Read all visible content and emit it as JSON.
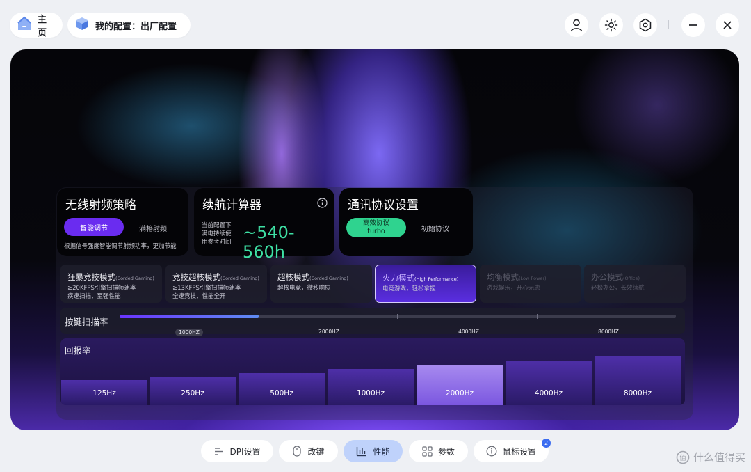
{
  "header": {
    "home_label": "主页",
    "config_label": "我的配置：出厂配置",
    "icons": [
      "user-icon",
      "brightness-icon",
      "settings-hex-icon",
      "minimize-icon",
      "close-icon"
    ]
  },
  "radio": {
    "title": "无线射频策略",
    "smart_label": "智能调节",
    "full_label": "满格射频",
    "desc": "根据信号强度智能调节射频功率，更加节能"
  },
  "battery": {
    "title": "续航计算器",
    "label": "当前配置下\n满电持续使\n用参考时间",
    "value": "~540-560h"
  },
  "protocol": {
    "title": "通讯协议设置",
    "turbo_label_1": "高效协议",
    "turbo_label_2": "turbo",
    "init_label": "初始协议"
  },
  "modes": [
    {
      "title": "狂暴竞技模式",
      "en": "(Corded Gaming)",
      "desc": "≥20KFPS引擎扫描帧速率\n疾速扫描，至强性能"
    },
    {
      "title": "竞技超核模式",
      "en": "(Corded Gaming)",
      "desc": "≥13KFPS引擎扫描帧速率\n全速竞技，性能全开"
    },
    {
      "title": "超核模式",
      "en": "(Corded Gaming)",
      "desc": "超核电竞，微秒响应"
    },
    {
      "title": "火力模式",
      "en": "(High Performance)",
      "desc": "电竞游戏，轻松拿捏"
    },
    {
      "title": "均衡模式",
      "en": "(Low Power)",
      "desc": "游戏娱乐，开心无虑"
    },
    {
      "title": "办公模式",
      "en": "(Office)",
      "desc": "轻松办公，长效续航"
    }
  ],
  "active_mode_index": 3,
  "scan": {
    "title": "按键扫描率",
    "labels": [
      "1000HZ",
      "2000HZ",
      "4000HZ",
      "8000HZ"
    ],
    "selected_index": 0,
    "fill_fraction": 0.25
  },
  "report": {
    "title": "回报率",
    "rates": [
      "125Hz",
      "250Hz",
      "500Hz",
      "1000Hz",
      "2000Hz",
      "4000Hz",
      "8000Hz"
    ],
    "selected_index": 4
  },
  "nav": [
    {
      "label": "DPI设置",
      "icon": "dpi-sliders-icon"
    },
    {
      "label": "改键",
      "icon": "mouse-icon"
    },
    {
      "label": "性能",
      "icon": "performance-chart-icon"
    },
    {
      "label": "参数",
      "icon": "grid-icon"
    },
    {
      "label": "鼠标设置",
      "icon": "info-circle-icon"
    }
  ],
  "nav_active_index": 2,
  "nav_badge": "2",
  "watermark": "什么值得买",
  "colors": {
    "accent_purple": "#6a2cf0",
    "accent_green": "#2fd38f",
    "battery_value": "#3ee0a4",
    "nav_active": "#bfd2fb"
  }
}
